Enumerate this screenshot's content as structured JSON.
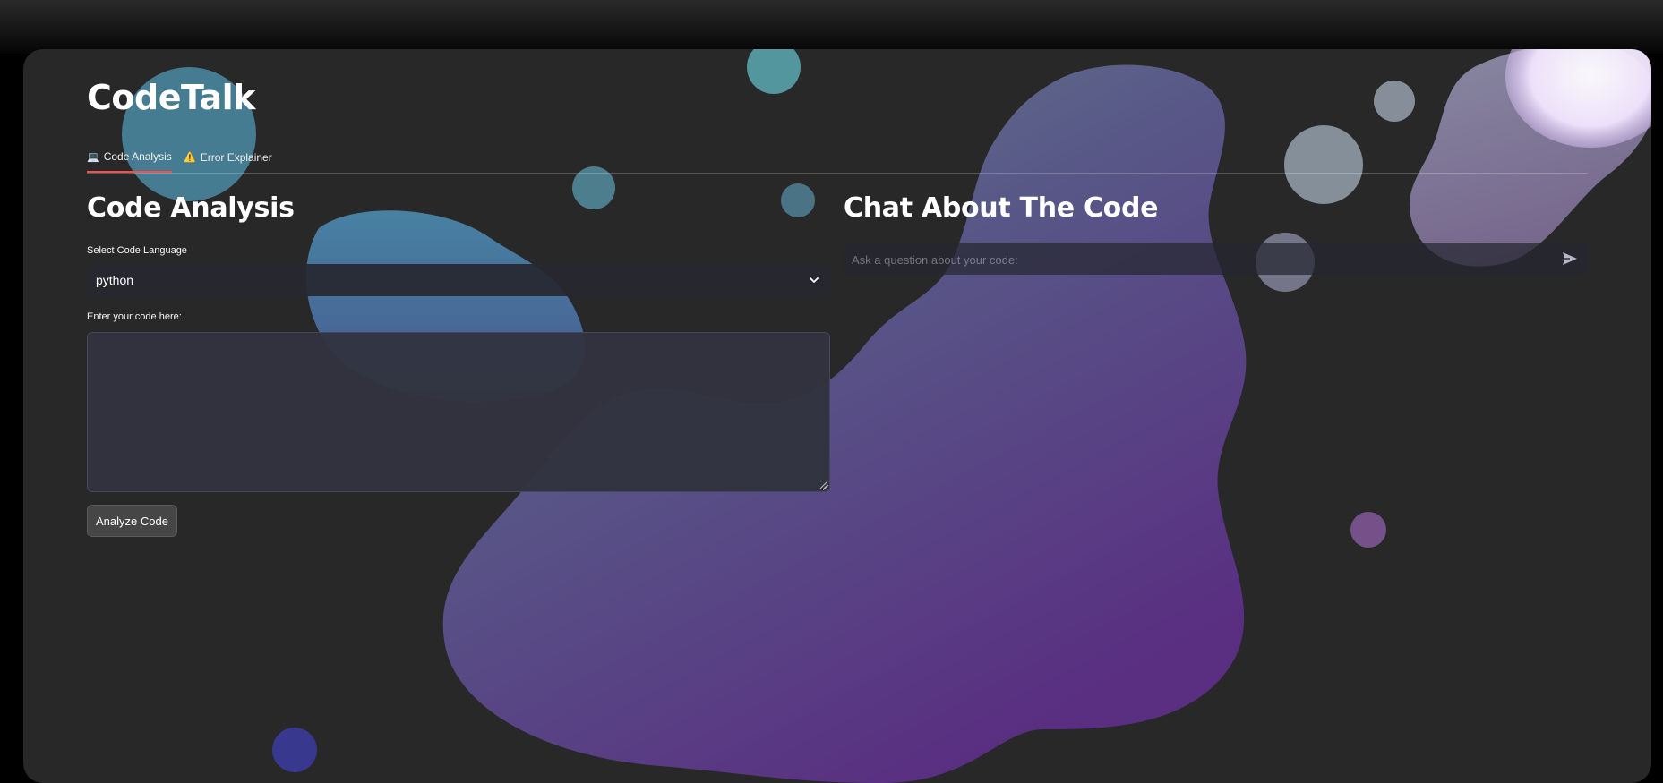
{
  "app": {
    "title": "CodeTalk"
  },
  "tabs": [
    {
      "icon": "laptop-icon",
      "glyph": "💻",
      "label": "Code Analysis",
      "active": true
    },
    {
      "icon": "warning-icon",
      "glyph": "⚠️",
      "label": "Error Explainer",
      "active": false
    }
  ],
  "analysis": {
    "title": "Code Analysis",
    "language_label": "Select Code Language",
    "language_value": "python",
    "code_label": "Enter your code here:",
    "code_value": "",
    "button_label": "Analyze Code"
  },
  "chat": {
    "title": "Chat About The Code",
    "placeholder": "Ask a question about your code:",
    "value": ""
  },
  "colors": {
    "accent": "#ff4b4b",
    "background": "#282828",
    "input_bg": "#262730"
  }
}
